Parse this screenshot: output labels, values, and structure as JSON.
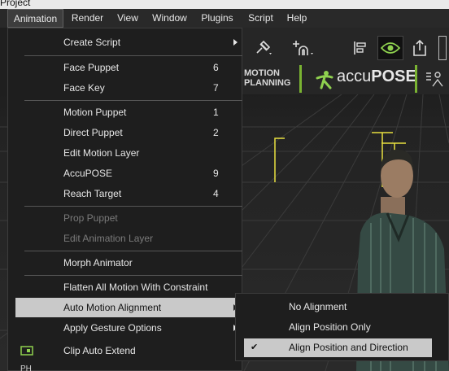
{
  "title": "Project",
  "menubar": {
    "items": [
      {
        "label": "Animation"
      },
      {
        "label": "Render"
      },
      {
        "label": "View"
      },
      {
        "label": "Window"
      },
      {
        "label": "Plugins"
      },
      {
        "label": "Script"
      },
      {
        "label": "Help"
      }
    ]
  },
  "toolbar": {
    "brand1": "MOTION\nPLANNING",
    "brand2_a": "accu",
    "brand2_b": "POSE"
  },
  "menu": {
    "items": [
      {
        "label": "Create Script",
        "shortcut": ""
      },
      {
        "label": "Face Puppet",
        "shortcut": "6"
      },
      {
        "label": "Face Key",
        "shortcut": "7"
      },
      {
        "label": "Motion Puppet",
        "shortcut": "1"
      },
      {
        "label": "Direct Puppet",
        "shortcut": "2"
      },
      {
        "label": "Edit Motion Layer",
        "shortcut": ""
      },
      {
        "label": "AccuPOSE",
        "shortcut": "9"
      },
      {
        "label": "Reach Target",
        "shortcut": "4"
      },
      {
        "label": "Prop Puppet",
        "shortcut": ""
      },
      {
        "label": "Edit Animation Layer",
        "shortcut": ""
      },
      {
        "label": "Morph Animator",
        "shortcut": ""
      },
      {
        "label": "Flatten All Motion With Constraint",
        "shortcut": ""
      },
      {
        "label": "Auto Motion Alignment",
        "shortcut": ""
      },
      {
        "label": "Apply Gesture Options",
        "shortcut": ""
      },
      {
        "label": "Clip Auto Extend",
        "shortcut": ""
      }
    ]
  },
  "submenu": {
    "items": [
      {
        "label": "No Alignment"
      },
      {
        "label": "Align Position Only"
      },
      {
        "label": "Align Position and Direction"
      }
    ],
    "check": "✔"
  },
  "bottom_label": "PH"
}
